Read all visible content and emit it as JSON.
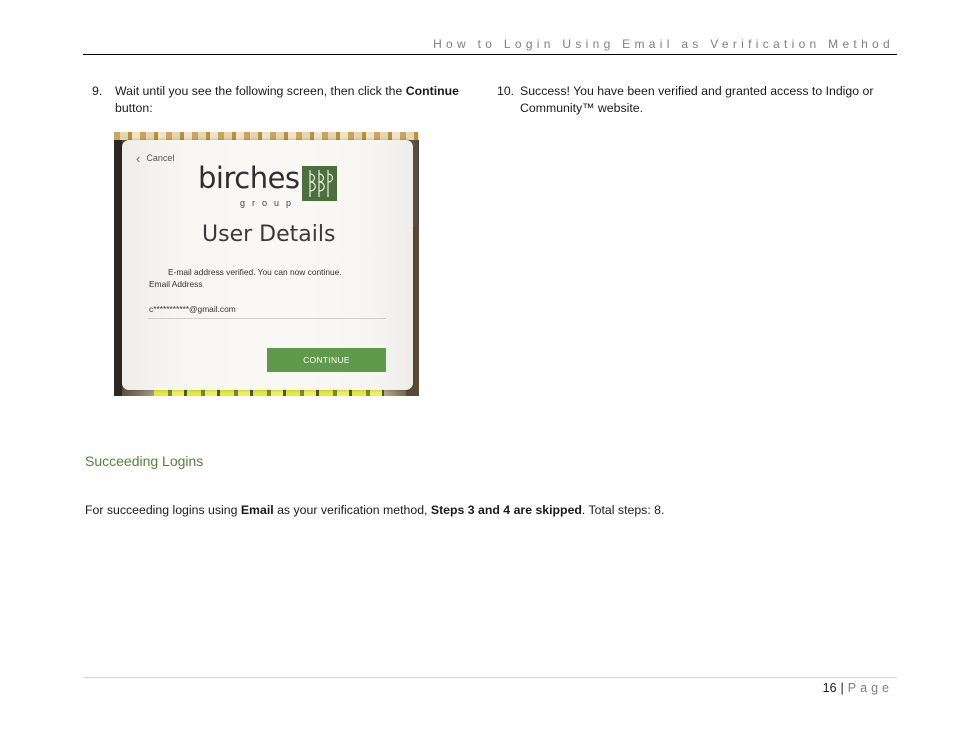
{
  "header": {
    "title": "How to Login Using Email as Verification Method"
  },
  "steps": {
    "step9": {
      "number": "9.",
      "text_before": "Wait until you see the following screen, then click the ",
      "bold": "Continue",
      "text_after": " button:"
    },
    "step10": {
      "number": "10.",
      "text": "Success! You have been verified and granted access to Indigo or Community™ website."
    }
  },
  "screenshot": {
    "cancel_label": "Cancel",
    "brand_name": "birches",
    "brand_sub": "group",
    "heading": "User Details",
    "message": "E-mail address verified. You can now continue.",
    "email_label": "Email Address",
    "email_value": "c***********@gmail.com",
    "continue_label": "CONTINUE",
    "accent": "#5f9a4c"
  },
  "section": {
    "heading": "Succeeding Logins",
    "para_1": "For succeeding logins using ",
    "para_bold_1": "Email",
    "para_2": " as your verification method, ",
    "para_bold_2": "Steps 3 and 4 are skipped",
    "para_3": ". Total steps: 8."
  },
  "footer": {
    "page_number": "16",
    "separator": "|",
    "page_label": "Page"
  }
}
